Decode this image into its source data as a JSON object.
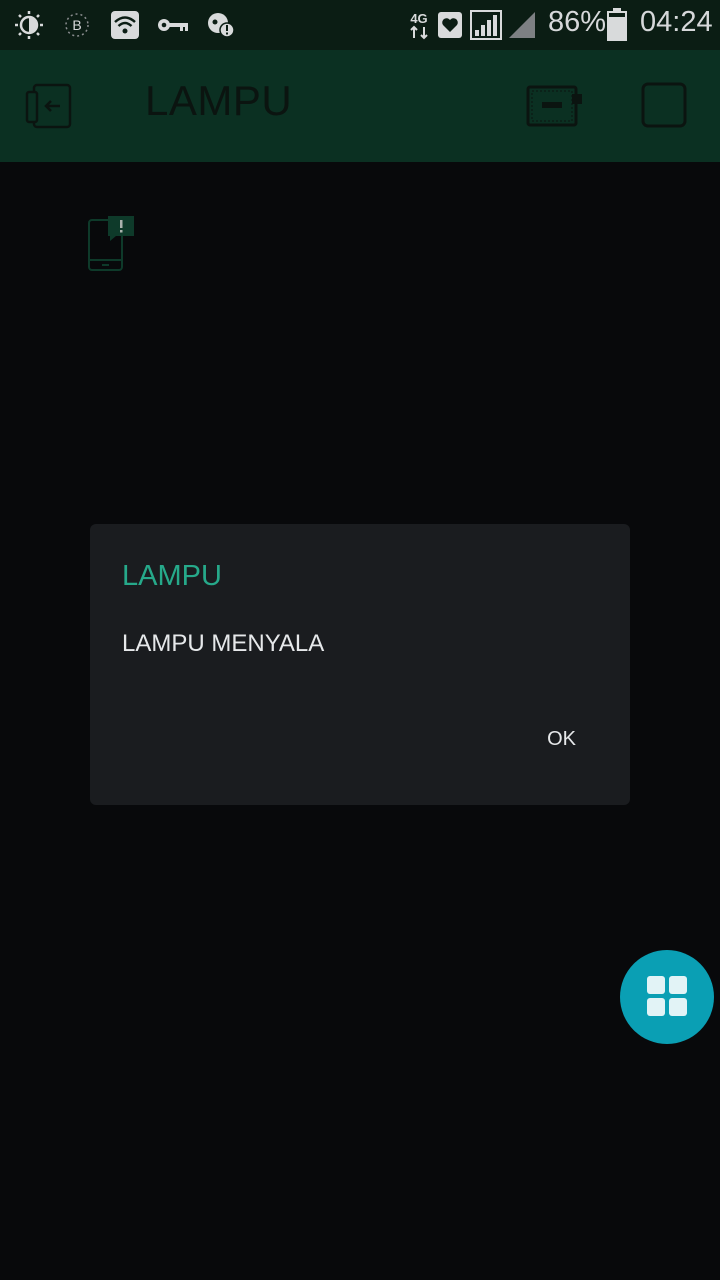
{
  "status_bar": {
    "network": "4G",
    "battery_percent": "86%",
    "time": "04:24",
    "icons": [
      "brightness-icon",
      "bluetooth-icon",
      "wifi-icon",
      "vpn-key-icon",
      "data-alert-icon",
      "network-4g-icon",
      "heart-icon",
      "signal-icon",
      "signal-empty-icon",
      "battery-icon"
    ]
  },
  "app_bar": {
    "title": "LAMPU",
    "actions": [
      "exit-icon",
      "device-icon",
      "stop-square-icon"
    ]
  },
  "content": {
    "widget": "notification-widget-icon"
  },
  "dialog": {
    "title": "LAMPU",
    "message": "LAMPU MENYALA",
    "ok_label": "OK"
  },
  "fab": {
    "icon": "widget-grid-icon"
  },
  "colors": {
    "status_bar_bg": "#0b1d14",
    "app_bar_bg": "#0b3022",
    "screen_bg": "#08090b",
    "dialog_bg": "#1a1c1f",
    "dialog_title": "#26a98a",
    "fab_bg": "#0a9fb4"
  }
}
